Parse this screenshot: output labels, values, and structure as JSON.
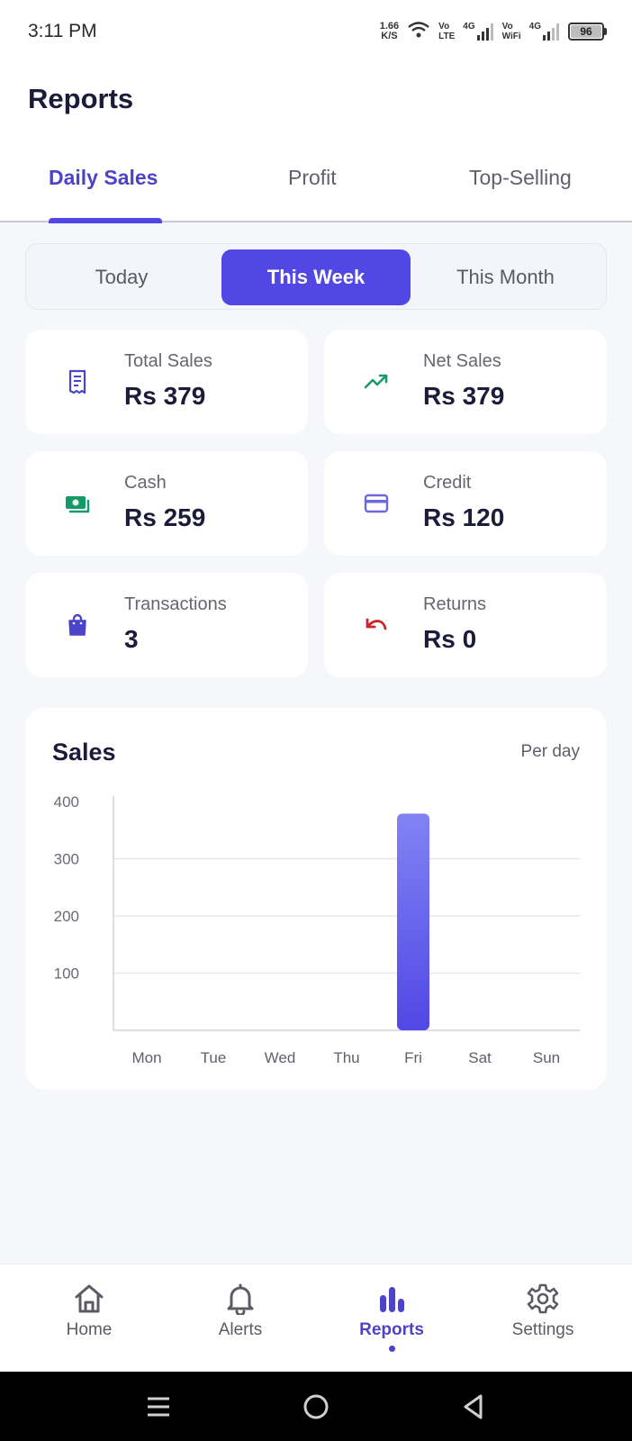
{
  "status_bar": {
    "time": "3:11 PM",
    "net_speed_value": "1.66",
    "net_speed_unit": "K/S",
    "volte_top": "Vo",
    "volte_bottom": "LTE",
    "signal_label": "4G",
    "vowifi_top": "Vo",
    "vowifi_bottom": "WiFi",
    "signal2_label": "4G",
    "battery": "96"
  },
  "header": {
    "title": "Reports"
  },
  "tabs": [
    {
      "label": "Daily Sales",
      "active": true
    },
    {
      "label": "Profit",
      "active": false
    },
    {
      "label": "Top-Selling",
      "active": false
    }
  ],
  "periods": [
    {
      "label": "Today",
      "active": false
    },
    {
      "label": "This Week",
      "active": true
    },
    {
      "label": "This Month",
      "active": false
    }
  ],
  "stats": [
    {
      "label": "Total Sales",
      "value": "Rs 379",
      "icon": "receipt-icon",
      "color": "#4b44c9",
      "bg": "#efeefb"
    },
    {
      "label": "Net Sales",
      "value": "Rs 379",
      "icon": "trending-up-icon",
      "color": "#169a6a",
      "bg": "#e9f7f1"
    },
    {
      "label": "Cash",
      "value": "Rs 259",
      "icon": "cash-icon",
      "color": "#139a67",
      "bg": "#e9f7f1"
    },
    {
      "label": "Credit",
      "value": "Rs 120",
      "icon": "credit-card-icon",
      "color": "#6d68e0",
      "bg": "#f1f1fb"
    },
    {
      "label": "Transactions",
      "value": "3",
      "icon": "shopping-bag-icon",
      "color": "#4b44c9",
      "bg": "#efeefb"
    },
    {
      "label": "Returns",
      "value": "Rs 0",
      "icon": "undo-icon",
      "color": "#c8242a",
      "bg": "#fcecec"
    }
  ],
  "chart_data": {
    "type": "bar",
    "title": "Sales",
    "subtitle": "Per day",
    "categories": [
      "Mon",
      "Tue",
      "Wed",
      "Thu",
      "Fri",
      "Sat",
      "Sun"
    ],
    "values": [
      0,
      0,
      0,
      0,
      379,
      0,
      0
    ],
    "yticks": [
      100,
      200,
      300,
      400
    ],
    "ylim": [
      0,
      400
    ],
    "grid": true,
    "bar_color_top": "#8183f4",
    "bar_color_bottom": "#5147e5"
  },
  "bottom_nav": [
    {
      "label": "Home",
      "icon": "home-icon",
      "active": false
    },
    {
      "label": "Alerts",
      "icon": "bell-icon",
      "active": false
    },
    {
      "label": "Reports",
      "icon": "bar-chart-icon",
      "active": true
    },
    {
      "label": "Settings",
      "icon": "gear-icon",
      "active": false
    }
  ],
  "accent_color": "#5147e5"
}
